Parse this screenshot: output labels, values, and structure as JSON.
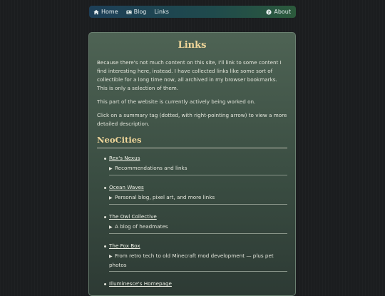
{
  "nav": {
    "home_label": "Home",
    "blog_label": "Blog",
    "links_label": "Links",
    "about_label": "About"
  },
  "main": {
    "title": "Links",
    "paragraphs": [
      "Because there's not much content on this site, I'll link to some content I find interesting here, instead. I have collected links like some sort of collectible for a long time now, all archived in my browser bookmarks. This is only a selection of them.",
      "This part of the website is currently actively being worked on.",
      "Click on a summary tag (dotted, with right-pointing arrow) to view a more detailed description."
    ],
    "section_heading": "NeoCities",
    "links": [
      {
        "name": "Rex's Nexus",
        "summary": "Recommendations and links"
      },
      {
        "name": "Ocean Waves",
        "summary": "Personal blog, pixel art, and more links"
      },
      {
        "name": "The Owl Collective",
        "summary": "A blog of headmates"
      },
      {
        "name": "The Fox Box",
        "summary": "From retro tech to old Minecraft mod development — plus pet photos"
      },
      {
        "name": "Illuminesce's Homepage",
        "summary": ""
      }
    ]
  },
  "colors": {
    "accent_gold": "#f1d79a",
    "nav_start": "#1d3f58",
    "nav_end": "#2c5a3c"
  },
  "icons": {
    "home": "house-icon",
    "blog": "newspaper-icon",
    "about": "question-circle-icon",
    "disclosure": "triangle-right-icon"
  }
}
